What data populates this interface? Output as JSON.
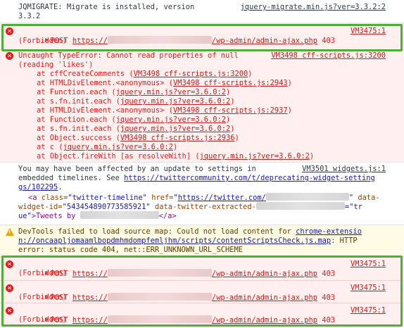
{
  "row_migrate": {
    "line1": "JQMIGRATE: Migrate is installed, version",
    "line2": "3.3.2",
    "source": "jquery-migrate.min.js?ver=3.3.2:2"
  },
  "post_rows": [
    {
      "method": "POST",
      "url_prefix": "https://",
      "url_suffix": "/wp-admin/admin-ajax.php",
      "status": "403",
      "status_text": "(Forbidden)",
      "source": "VM3475:1"
    },
    {
      "method": "POST",
      "url_prefix": "https://",
      "url_suffix": "/wp-admin/admin-ajax.php",
      "status": "403",
      "status_text": "(Forbidden)",
      "source": "VM3475:1"
    },
    {
      "method": "POST",
      "url_prefix": "https://",
      "url_suffix": "/wp-admin/admin-ajax.php",
      "status": "403",
      "status_text": "(Forbidden)",
      "source": "VM3475:1"
    },
    {
      "method": "POST",
      "url_prefix": "https://",
      "url_suffix": "/wp-admin/admin-ajax.php",
      "status": "403",
      "status_text": "(Forbidden)",
      "source": "VM3475:1"
    }
  ],
  "type_error": {
    "message_line1": "Uncaught TypeError: Cannot read properties of null",
    "message_line2": "(reading 'likes')",
    "source": "VM3498 cff-scripts.js:3200",
    "stack": [
      {
        "fn": "at cffCreateComments (",
        "loc": "VM3498 cff-scripts.js:3200",
        "end": ")"
      },
      {
        "fn": "at HTMLDivElement.<anonymous> (",
        "loc": "VM3498 cff-scripts.js:2943",
        "end": ")"
      },
      {
        "fn": "at Function.each (",
        "loc": "jquery.min.js?ver=3.6.0:2",
        "end": ")"
      },
      {
        "fn": "at s.fn.init.each (",
        "loc": "jquery.min.js?ver=3.6.0:2",
        "end": ")"
      },
      {
        "fn": "at HTMLDivElement.<anonymous> (",
        "loc": "VM3498 cff-scripts.js:2937",
        "end": ")"
      },
      {
        "fn": "at Function.each (",
        "loc": "jquery.min.js?ver=3.6.0:2",
        "end": ")"
      },
      {
        "fn": "at s.fn.init.each (",
        "loc": "jquery.min.js?ver=3.6.0:2",
        "end": ")"
      },
      {
        "fn": "at Object.success (",
        "loc": "VM3498 cff-scripts.js:2936",
        "end": ")"
      },
      {
        "fn": "at c (",
        "loc": "jquery.min.js?ver=3.6.0:2",
        "end": ")"
      },
      {
        "fn": "at Object.fireWith [as resolveWith] (",
        "loc": "jquery.min.js?ver=3.6.0:2",
        "end": ")"
      }
    ]
  },
  "twitter_notice": {
    "line1": "You may have been affected by an update to settings in",
    "line2_text": "embedded timelines. See ",
    "line2_link": "https://twittercommunity.com/t/deprecating-widget-setting",
    "line3_link": "gs/102295",
    "line3_end": ".",
    "source": "VM3501 widgets.js:1",
    "code_tag_open": "<a ",
    "code_attr_class": "class=",
    "code_val_class": "\"twitter-timeline\"",
    "code_attr_href": " href=",
    "code_val_href_link": "https://twitter.com/",
    "code_val_href_end": "\"",
    "code_attr_data": " data-",
    "code_attr_widget": "widget-id=",
    "code_val_widget": "\"543454890773585921\"",
    "code_attr_extracted": " data-twitter-extracted-",
    "code_attr_eq": "=\"tr",
    "code_val_true": "ue\"",
    "code_tag_close1": ">Tweets by ",
    "code_tag_close2": "</a>"
  },
  "devtools_warning": {
    "line1_text": "DevTools failed to load source map: Could not load content for ",
    "line1_link": "chrome-extensio",
    "line2_link": "n://oncaapljomaamlbopdmhmdompfemljhm/scripts/contentScriptsCheck.js.map",
    "line2_end": ": HTTP",
    "line3": "error: status code 404, net::ERR_UNKNOWN_URL_SCHEME"
  },
  "colors": {
    "error_text": "#e41e1e",
    "error_bg": "#fff0f0",
    "warning_bg": "#fffbe5",
    "highlight_box": "#4caf37"
  }
}
